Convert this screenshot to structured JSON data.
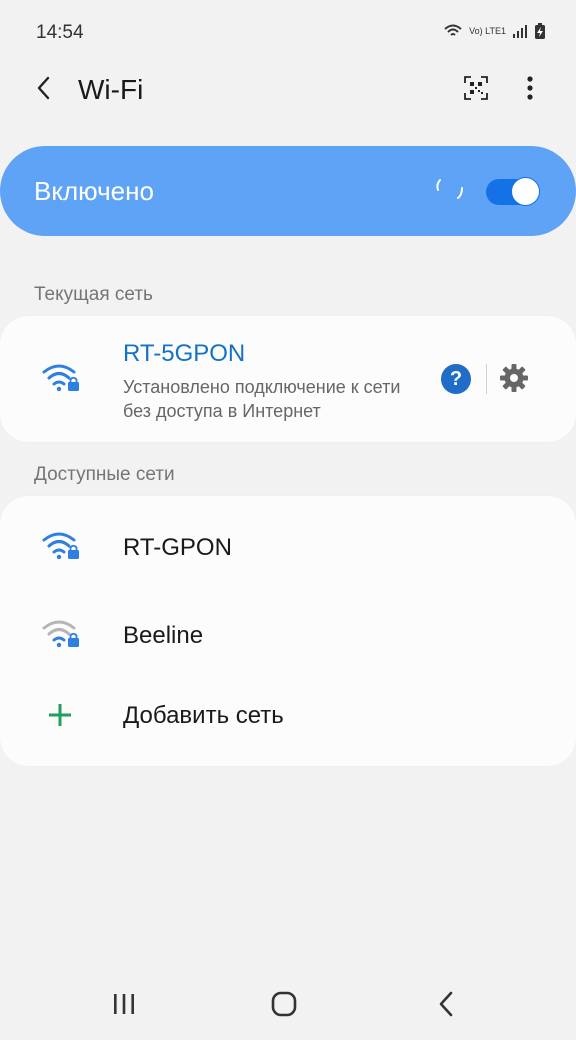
{
  "status_bar": {
    "time": "14:54",
    "lte_label": "Vo) LTE1",
    "icons": [
      "wifi-signal-icon",
      "cell-signal-icon",
      "battery-charging-icon"
    ]
  },
  "app_bar": {
    "title": "Wi-Fi",
    "back_icon": "chevron-left-icon",
    "qr_icon": "qr-code-icon",
    "more_icon": "more-vertical-icon"
  },
  "master_toggle": {
    "label": "Включено",
    "enabled": true,
    "scanning": true
  },
  "current_network": {
    "header": "Текущая сеть",
    "name": "RT-5GPON",
    "status": "Установлено подключение к сети без доступа в Интернет",
    "help_label": "?",
    "secured": true
  },
  "available_networks": {
    "header": "Доступные сети",
    "items": [
      {
        "name": "RT-GPON",
        "secured": true,
        "signal_color": "#2f7fe0"
      },
      {
        "name": "Beeline",
        "secured": true,
        "signal_color": "#a8a8a8"
      }
    ],
    "add_label": "Добавить сеть"
  },
  "colors": {
    "accent": "#1572e6",
    "toggle_bar": "#5ea3f5",
    "connected_text": "#1572c4",
    "add_icon": "#1fa060"
  },
  "nav_bar": {
    "icons": [
      "recents-icon",
      "home-icon",
      "back-icon"
    ]
  }
}
